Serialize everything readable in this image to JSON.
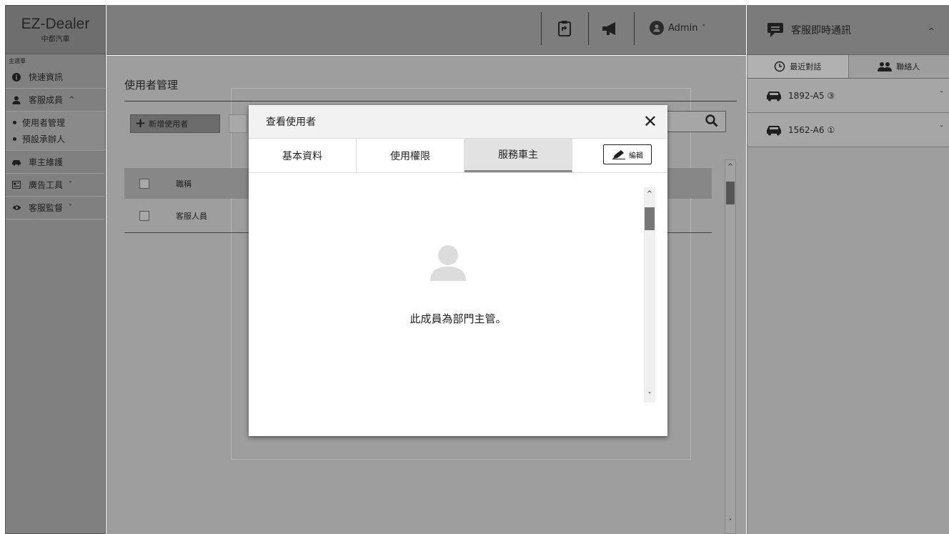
{
  "sidebar": {
    "brand": "EZ-Dealer",
    "brand_sub": "中都汽車",
    "menu_caption": "主選單",
    "items": {
      "quick_info": "快速資訊",
      "service_members": "客服成員",
      "user_management": "使用者管理",
      "default_handler": "預設承辦人",
      "owner_maintenance": "車主維護",
      "ad_tools": "廣告工具",
      "service_monitor": "客服監督"
    }
  },
  "topbar": {
    "admin_label": "Admin"
  },
  "page": {
    "title": "使用者管理",
    "add_user_label": "新增使用者",
    "table": {
      "header_job_title": "職稱",
      "rows": [
        "客服人員"
      ]
    }
  },
  "chat": {
    "title": "客服即時通訊",
    "tab_recent": "最近對話",
    "tab_contacts": "聯絡人",
    "items": [
      {
        "plate": "1892-A5",
        "count": "③"
      },
      {
        "plate": "1562-A6",
        "count": "①"
      }
    ]
  },
  "modal": {
    "title": "查看使用者",
    "tabs": [
      "基本資料",
      "使用權限",
      "服務車主"
    ],
    "active_tab": "服務車主",
    "edit_label": "編輯",
    "message": "此成員為部門主管。"
  },
  "icons": {
    "close": "close-icon",
    "search": "search-icon",
    "edit": "pencil-icon",
    "avatar": "user-icon",
    "car": "car-icon",
    "chat": "chat-bubble-icon",
    "clock": "clock-icon",
    "contacts": "contacts-icon",
    "megaphone": "megaphone-icon",
    "clipboard": "clipboard-icon"
  }
}
